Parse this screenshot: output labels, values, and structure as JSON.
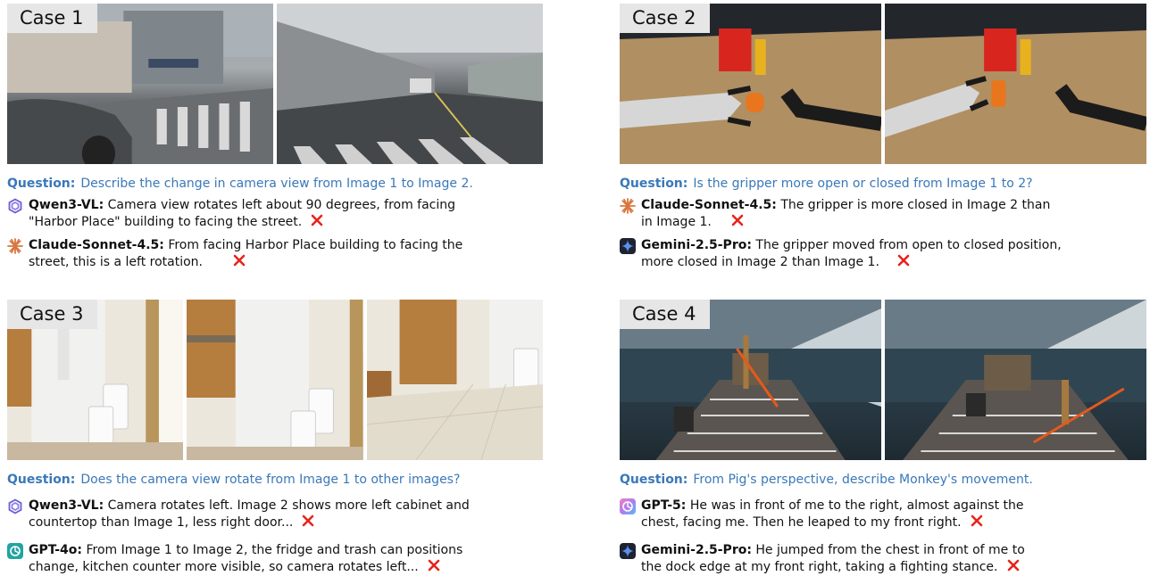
{
  "cases": [
    {
      "label": "Case 1",
      "question_label": "Question:",
      "question": "Describe the change in camera view from Image 1 to Image 2.",
      "answers": [
        {
          "model": "Qwen3-VL:",
          "line1": "Camera view rotates left about 90 degrees, from facing",
          "line2": "\"Harbor Place\" building to facing the street."
        },
        {
          "model": "Claude-Sonnet-4.5:",
          "line1": "From facing Harbor Place building to facing the",
          "line2": "street, this is a left rotation."
        }
      ]
    },
    {
      "label": "Case 2",
      "question_label": "Question:",
      "question": "Is the gripper more open or closed from Image 1 to 2?",
      "answers": [
        {
          "model": "Claude-Sonnet-4.5:",
          "line1": "The gripper is more closed in Image 2 than",
          "line2": "in Image 1."
        },
        {
          "model": "Gemini-2.5-Pro:",
          "line1": "The gripper moved from open to closed position,",
          "line2": "more closed in Image 2 than Image 1."
        }
      ]
    },
    {
      "label": "Case 3",
      "question_label": "Question:",
      "question": "Does the camera view rotate from Image 1 to other images?",
      "answers": [
        {
          "model": "Qwen3-VL:",
          "line1": "Camera rotates left. Image 2 shows more left cabinet and",
          "line2": "countertop than Image 1, less right door..."
        },
        {
          "model": "GPT-4o:",
          "line1": "From Image 1 to Image 2, the fridge and trash can positions",
          "line2": "change, kitchen counter more visible, so camera rotates left..."
        }
      ]
    },
    {
      "label": "Case 4",
      "question_label": "Question:",
      "question": "From Pig's perspective, describe Monkey's movement.",
      "answers": [
        {
          "model": "GPT-5:",
          "line1": "He was in front of me to the right, almost against the",
          "line2": "chest, facing me. Then he leaped to my front right."
        },
        {
          "model": "Gemini-2.5-Pro:",
          "line1": "He jumped from the chest in front of me to",
          "line2": "the dock edge at my front right, taking a fighting stance."
        }
      ]
    }
  ],
  "colors": {
    "question": "#3a78b8",
    "cross": "#e8231c",
    "label_bg": "#e6e6e6"
  }
}
